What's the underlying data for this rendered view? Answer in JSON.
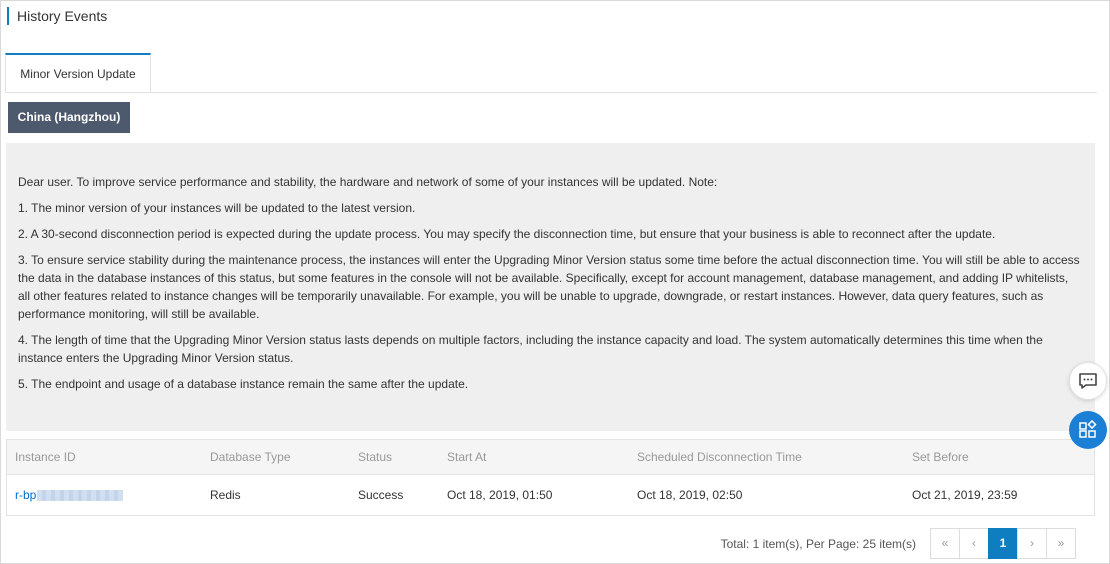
{
  "header": {
    "title": "History Events"
  },
  "tabs": [
    {
      "label": "Minor Version Update",
      "active": true
    }
  ],
  "region_button": "China (Hangzhou)",
  "notice": {
    "intro": "Dear user. To improve service performance and stability, the hardware and network of some of your instances will be updated. Note:",
    "items": [
      "1. The minor version of your instances will be updated to the latest version.",
      "2. A 30-second disconnection period is expected during the update process. You may specify the disconnection time, but ensure that your business is able to reconnect after the update.",
      "3. To ensure service stability during the maintenance process, the instances will enter the Upgrading Minor Version status some time before the actual disconnection time. You will still be able to access the data in the database instances of this status, but some features in the console will not be available. Specifically, except for account management, database management, and adding IP whitelists, all other features related to instance changes will be temporarily unavailable. For example, you will be unable to upgrade, downgrade, or restart instances. However, data query features, such as performance monitoring, will still be available.",
      "4. The length of time that the Upgrading Minor Version status lasts depends on multiple factors, including the instance capacity and load. The system automatically determines this time when the instance enters the Upgrading Minor Version status.",
      "5. The endpoint and usage of a database instance remain the same after the update."
    ]
  },
  "table": {
    "columns": [
      "Instance ID",
      "Database Type",
      "Status",
      "Start At",
      "Scheduled Disconnection Time",
      "Set Before"
    ],
    "rows": [
      {
        "instance_id": "r-bp",
        "database_type": "Redis",
        "status": "Success",
        "start_at": "Oct 18, 2019, 01:50",
        "scheduled_disconnection_time": "Oct 18, 2019, 02:50",
        "set_before": "Oct 21, 2019, 23:59"
      }
    ]
  },
  "pagination": {
    "summary": "Total: 1 item(s), Per Page: 25 item(s)",
    "first": "«",
    "prev": "‹",
    "current": "1",
    "next": "›",
    "last": "»"
  },
  "floating": {
    "chat_icon": "chat-icon",
    "apps_icon": "apps-icon"
  },
  "colors": {
    "accent": "#0f7ec1",
    "region_button": "#4d5a6d",
    "notice_bg": "#efefef",
    "link": "#0070cc"
  }
}
